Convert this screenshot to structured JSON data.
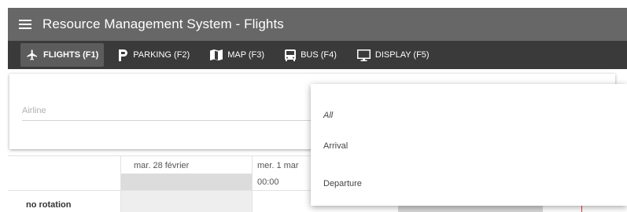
{
  "app": {
    "title": "Resource Management System - Flights",
    "menu_icon": "hamburger-menu-icon"
  },
  "tabs": [
    {
      "label": "FLIGHTS (F1)",
      "icon": "airplane-icon",
      "active": true
    },
    {
      "label": "PARKING (F2)",
      "icon": "parking-icon",
      "active": false
    },
    {
      "label": "MAP (F3)",
      "icon": "map-icon",
      "active": false
    },
    {
      "label": "BUS (F4)",
      "icon": "bus-icon",
      "active": false
    },
    {
      "label": "DISPLAY (F5)",
      "icon": "monitor-icon",
      "active": false
    }
  ],
  "filter": {
    "airline_placeholder": "Airline"
  },
  "dropdown": {
    "options": [
      "All",
      "Arrival",
      "Departure"
    ]
  },
  "schedule": {
    "dates": [
      "mar. 28 février",
      "mer. 1 mar"
    ],
    "time": "00:00",
    "row_label": "no rotation"
  },
  "colors": {
    "titlebar": "#676767",
    "tabbar": "#3a3a3a",
    "active_tab": "#5c5c5c",
    "marker": "#e53935"
  }
}
